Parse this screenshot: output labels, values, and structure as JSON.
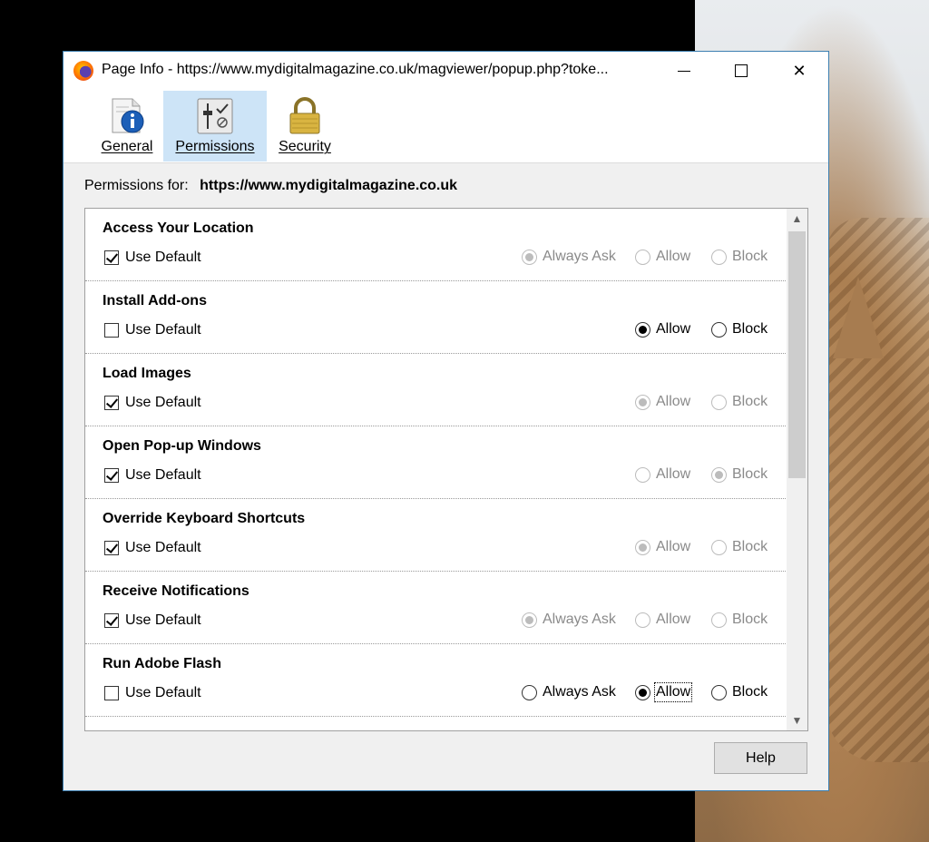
{
  "window": {
    "title": "Page Info - https://www.mydigitalmagazine.co.uk/magviewer/popup.php?toke...",
    "app_icon": "firefox-icon",
    "controls": {
      "minimize": "minimize-icon",
      "maximize": "maximize-icon",
      "close": "✕"
    }
  },
  "tabs": [
    {
      "label": "General",
      "icon": "info-document-icon",
      "selected": false
    },
    {
      "label": "Permissions",
      "icon": "sliders-checkmark-icon",
      "selected": true
    },
    {
      "label": "Security",
      "icon": "padlock-icon",
      "selected": false
    }
  ],
  "permissions_for": {
    "label": "Permissions for:",
    "site": "https://www.mydigitalmagazine.co.uk"
  },
  "permissions": [
    {
      "title": "Access Your Location",
      "use_default_label": "Use Default",
      "use_default": true,
      "options": {
        "ask": "Always Ask",
        "allow": "Allow",
        "block": "Block"
      },
      "selected": "ask"
    },
    {
      "title": "Install Add-ons",
      "use_default_label": "Use Default",
      "use_default": false,
      "options": {
        "allow": "Allow",
        "block": "Block"
      },
      "selected": "allow"
    },
    {
      "title": "Load Images",
      "use_default_label": "Use Default",
      "use_default": true,
      "options": {
        "allow": "Allow",
        "block": "Block"
      },
      "selected": "allow"
    },
    {
      "title": "Open Pop-up Windows",
      "use_default_label": "Use Default",
      "use_default": true,
      "options": {
        "allow": "Allow",
        "block": "Block"
      },
      "selected": "block"
    },
    {
      "title": "Override Keyboard Shortcuts",
      "use_default_label": "Use Default",
      "use_default": true,
      "options": {
        "allow": "Allow",
        "block": "Block"
      },
      "selected": "allow"
    },
    {
      "title": "Receive Notifications",
      "use_default_label": "Use Default",
      "use_default": true,
      "options": {
        "ask": "Always Ask",
        "allow": "Allow",
        "block": "Block"
      },
      "selected": "ask"
    },
    {
      "title": "Run Adobe Flash",
      "use_default_label": "Use Default",
      "use_default": false,
      "options": {
        "ask": "Always Ask",
        "allow": "Allow",
        "block": "Block"
      },
      "selected": "allow",
      "focused": "allow"
    }
  ],
  "scroll": {
    "up": "▲",
    "down": "▼"
  },
  "help_label": "Help",
  "colors": {
    "selected_tab": "#cde4f7",
    "window_border": "#3c7fb1"
  }
}
